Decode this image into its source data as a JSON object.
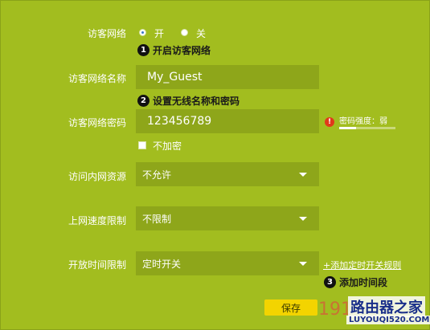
{
  "guest_network": {
    "label": "访客网络",
    "options": {
      "on": "开",
      "off": "关"
    },
    "selected": "on"
  },
  "steps": [
    {
      "num": "1",
      "text": "开启访客网络"
    },
    {
      "num": "2",
      "text": "设置无线名称和密码"
    },
    {
      "num": "3",
      "text": "添加时间段"
    }
  ],
  "guest_name": {
    "label": "访客网络名称",
    "value": "My_Guest"
  },
  "guest_password": {
    "label": "访客网络密码",
    "value": "123456789",
    "no_encrypt_label": "不加密",
    "strength_label": "密码强度：弱",
    "strength_level": 0.3,
    "warn_icon": "exclamation-icon"
  },
  "lan_access": {
    "label": "访问内网资源",
    "value": "不允许"
  },
  "speed_limit": {
    "label": "上网速度限制",
    "value": "不限制"
  },
  "open_time": {
    "label": "开放时间限制",
    "value": "定时开关",
    "add_rule_link": "+添加定时开关规则"
  },
  "save_button": "保存",
  "watermark": {
    "text1": "191",
    "text2": "路由器之家",
    "text3": "LUYOUQI520.COM"
  },
  "colors": {
    "background": "#a2bd1f",
    "field": "#8ea61a",
    "save": "#f3d400",
    "warn": "#e03a1a"
  }
}
